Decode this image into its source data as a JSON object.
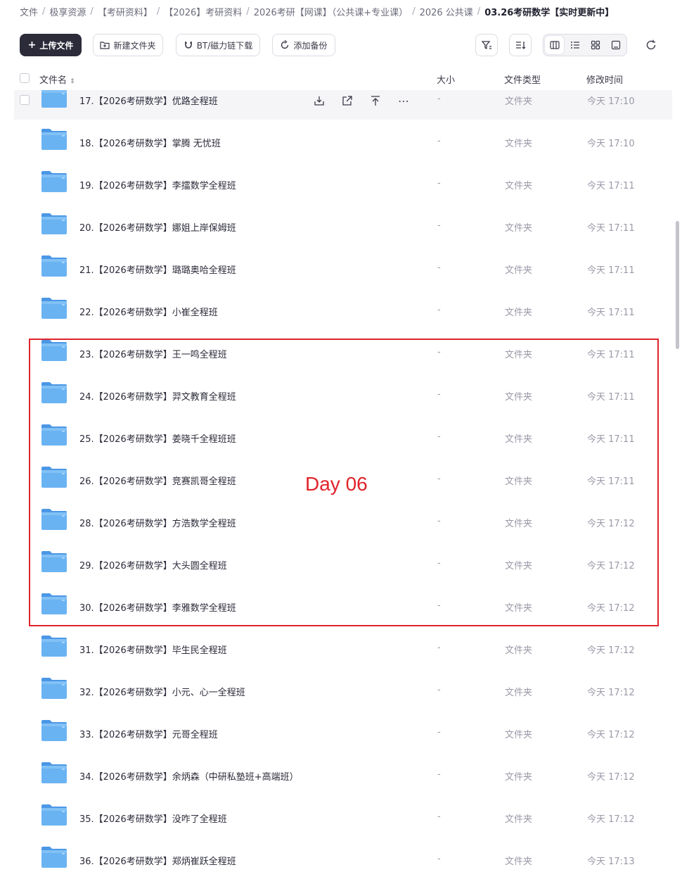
{
  "breadcrumb": [
    "文件",
    "极享资源",
    "【考研资料】",
    "【2026】考研资料",
    "2026考研【网课】（公共课+专业课）",
    "2026 公共课",
    "03.26考研数学【实时更新中】"
  ],
  "toolbar": {
    "upload_label": "上传文件",
    "new_folder_label": "新建文件夹",
    "bt_label": "BT/磁力链下载",
    "backup_label": "添加备份"
  },
  "columns": {
    "name": "文件名",
    "size": "大小",
    "type": "文件类型",
    "modified": "修改时间"
  },
  "files": [
    {
      "name": "17.【2026考研数学】优路全程班",
      "size": "-",
      "type": "文件夹",
      "time": "今天 17:10"
    },
    {
      "name": "18.【2026考研数学】掌腾 无忧班",
      "size": "-",
      "type": "文件夹",
      "time": "今天 17:10"
    },
    {
      "name": "19.【2026考研数学】李擂数学全程班",
      "size": "-",
      "type": "文件夹",
      "time": "今天 17:11"
    },
    {
      "name": "20.【2026考研数学】娜姐上岸保姆班",
      "size": "-",
      "type": "文件夹",
      "time": "今天 17:11"
    },
    {
      "name": "21.【2026考研数学】璐璐奥哈全程班",
      "size": "-",
      "type": "文件夹",
      "time": "今天 17:11"
    },
    {
      "name": "22.【2026考研数学】小崔全程班",
      "size": "-",
      "type": "文件夹",
      "time": "今天 17:11"
    },
    {
      "name": "23.【2026考研数学】王一鸣全程班",
      "size": "-",
      "type": "文件夹",
      "time": "今天 17:11"
    },
    {
      "name": "24.【2026考研数学】羿文教育全程班",
      "size": "-",
      "type": "文件夹",
      "time": "今天 17:11"
    },
    {
      "name": "25.【2026考研数学】姜晓千全程班班",
      "size": "-",
      "type": "文件夹",
      "time": "今天 17:11"
    },
    {
      "name": "26.【2026考研数学】竞赛凯哥全程班",
      "size": "-",
      "type": "文件夹",
      "time": "今天 17:11"
    },
    {
      "name": "28.【2026考研数学】方浩数学全程班",
      "size": "-",
      "type": "文件夹",
      "time": "今天 17:12"
    },
    {
      "name": "29.【2026考研数学】大头圆全程班",
      "size": "-",
      "type": "文件夹",
      "time": "今天 17:12"
    },
    {
      "name": "30.【2026考研数学】李雅数学全程班",
      "size": "-",
      "type": "文件夹",
      "time": "今天 17:12"
    },
    {
      "name": "31.【2026考研数学】毕生民全程班",
      "size": "-",
      "type": "文件夹",
      "time": "今天 17:12"
    },
    {
      "name": "32.【2026考研数学】小元、心一全程班",
      "size": "-",
      "type": "文件夹",
      "time": "今天 17:12"
    },
    {
      "name": "33.【2026考研数学】元哥全程班",
      "size": "-",
      "type": "文件夹",
      "time": "今天 17:12"
    },
    {
      "name": "34.【2026考研数学】余炳森（中研私塾班+高端班）",
      "size": "-",
      "type": "文件夹",
      "time": "今天 17:12"
    },
    {
      "name": "35.【2026考研数学】没咋了全程班",
      "size": "-",
      "type": "文件夹",
      "time": "今天 17:12"
    },
    {
      "name": "36.【2026考研数学】郑炳崔跃全程班",
      "size": "-",
      "type": "文件夹",
      "time": "今天 17:13"
    }
  ],
  "annotation": "Day 06",
  "colors": {
    "annotation": "#e0242b",
    "primary_button": "#2b2b3a",
    "folder": "#5aa7ee"
  }
}
